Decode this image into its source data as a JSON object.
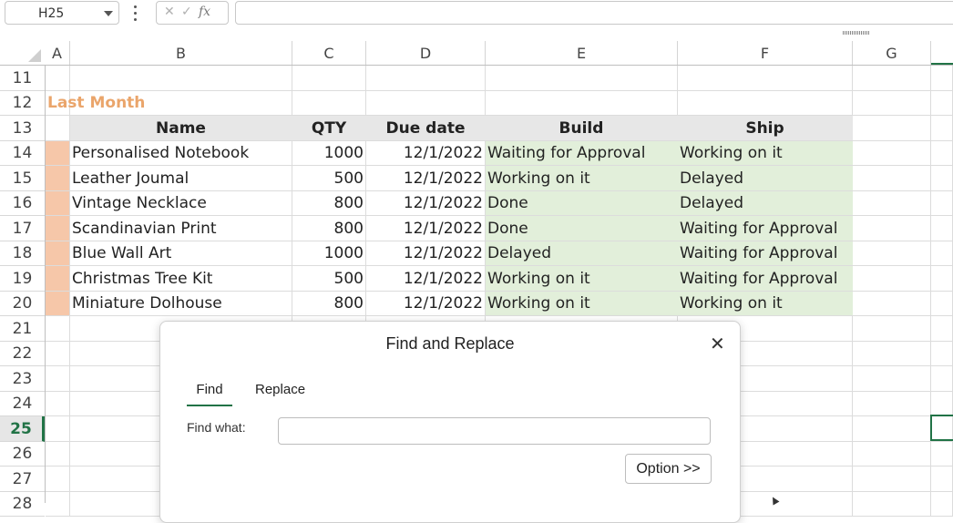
{
  "formula_bar": {
    "name_box": "H25",
    "fx_cancel": "✕",
    "fx_enter": "✓",
    "fx_label": "fx",
    "formula_value": ""
  },
  "columns": [
    "A",
    "B",
    "C",
    "D",
    "E",
    "F",
    "G"
  ],
  "selected_row": "25",
  "rows": [
    {
      "n": "11",
      "a": "",
      "b": "",
      "c": "",
      "d": "",
      "e": "",
      "f": ""
    },
    {
      "n": "12",
      "a": "Last Month",
      "b": "",
      "c": "",
      "d": "",
      "e": "",
      "f": ""
    },
    {
      "n": "13",
      "a": "",
      "b": "Name",
      "c": "QTY",
      "d": "Due date",
      "e": "Build",
      "f": "Ship"
    },
    {
      "n": "14",
      "a": "",
      "b": "Personalised Notebook",
      "c": "1000",
      "d": "12/1/2022",
      "e": "Waiting for Approval",
      "f": "Working on it"
    },
    {
      "n": "15",
      "a": "",
      "b": "Leather Joumal",
      "c": "500",
      "d": "12/1/2022",
      "e": "Working on it",
      "f": "Delayed"
    },
    {
      "n": "16",
      "a": "",
      "b": "Vintage Necklace",
      "c": "800",
      "d": "12/1/2022",
      "e": "Done",
      "f": "Delayed"
    },
    {
      "n": "17",
      "a": "",
      "b": "Scandinavian Print",
      "c": "800",
      "d": "12/1/2022",
      "e": "Done",
      "f": "Waiting for Approval"
    },
    {
      "n": "18",
      "a": "",
      "b": "Blue Wall Art",
      "c": "1000",
      "d": "12/1/2022",
      "e": "Delayed",
      "f": "Waiting for Approval"
    },
    {
      "n": "19",
      "a": "",
      "b": "Christmas Tree Kit",
      "c": "500",
      "d": "12/1/2022",
      "e": "Working on it",
      "f": "Waiting for Approval"
    },
    {
      "n": "20",
      "a": "",
      "b": "Miniature Dolhouse",
      "c": "800",
      "d": "12/1/2022",
      "e": "Working on it",
      "f": "Working on it"
    },
    {
      "n": "21",
      "a": "",
      "b": "",
      "c": "",
      "d": "",
      "e": "",
      "f": ""
    },
    {
      "n": "22",
      "a": "",
      "b": "",
      "c": "",
      "d": "",
      "e": "",
      "f": ""
    },
    {
      "n": "23",
      "a": "",
      "b": "",
      "c": "",
      "d": "",
      "e": "",
      "f": ""
    },
    {
      "n": "24",
      "a": "",
      "b": "",
      "c": "",
      "d": "",
      "e": "",
      "f": ""
    },
    {
      "n": "25",
      "a": "",
      "b": "",
      "c": "",
      "d": "",
      "e": "",
      "f": ""
    },
    {
      "n": "26",
      "a": "",
      "b": "",
      "c": "",
      "d": "",
      "e": "",
      "f": ""
    },
    {
      "n": "27",
      "a": "",
      "b": "",
      "c": "",
      "d": "",
      "e": "",
      "f": ""
    },
    {
      "n": "28",
      "a": "",
      "b": "",
      "c": "",
      "d": "",
      "e": "",
      "f": ""
    }
  ],
  "dialog": {
    "title": "Find and Replace",
    "close": "✕",
    "tabs": [
      "Find",
      "Replace"
    ],
    "active_tab": "Find",
    "find_label": "Find what:",
    "find_value": "",
    "options_button": "Option >>"
  },
  "colors": {
    "accent": "#217346",
    "title_orange": "#eaa56b",
    "peach": "#f6c7a9",
    "green_fill": "#e2efda",
    "header_fill": "#e7e7e7"
  }
}
